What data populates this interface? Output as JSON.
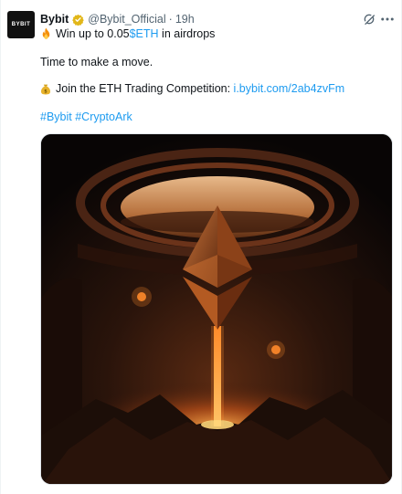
{
  "tweet": {
    "avatar_text": "BYBIT",
    "name": "Bybit",
    "handle": "@Bybit_Official",
    "separator": "·",
    "time": "19h",
    "line2_prefix": "Win up to 0.05 ",
    "line2_link": "$ETH",
    "line2_suffix": " in airdrops",
    "body_line1": "Time to make a move.",
    "body_line2_text": "Join the ETH Trading Competition: ",
    "body_line2_link": "i.bybit.com/2ab4zvFm",
    "hashtags": "#Bybit #CryptoArk",
    "icons": {
      "verified": "verified-badge-icon",
      "fire": "fire-emoji-icon",
      "money": "money-bag-emoji-icon",
      "grok": "grok-icon",
      "more": "more-icon"
    },
    "colors": {
      "link": "#1d9bf0",
      "secondary_text": "#536471",
      "badge": "#e2b719"
    }
  }
}
